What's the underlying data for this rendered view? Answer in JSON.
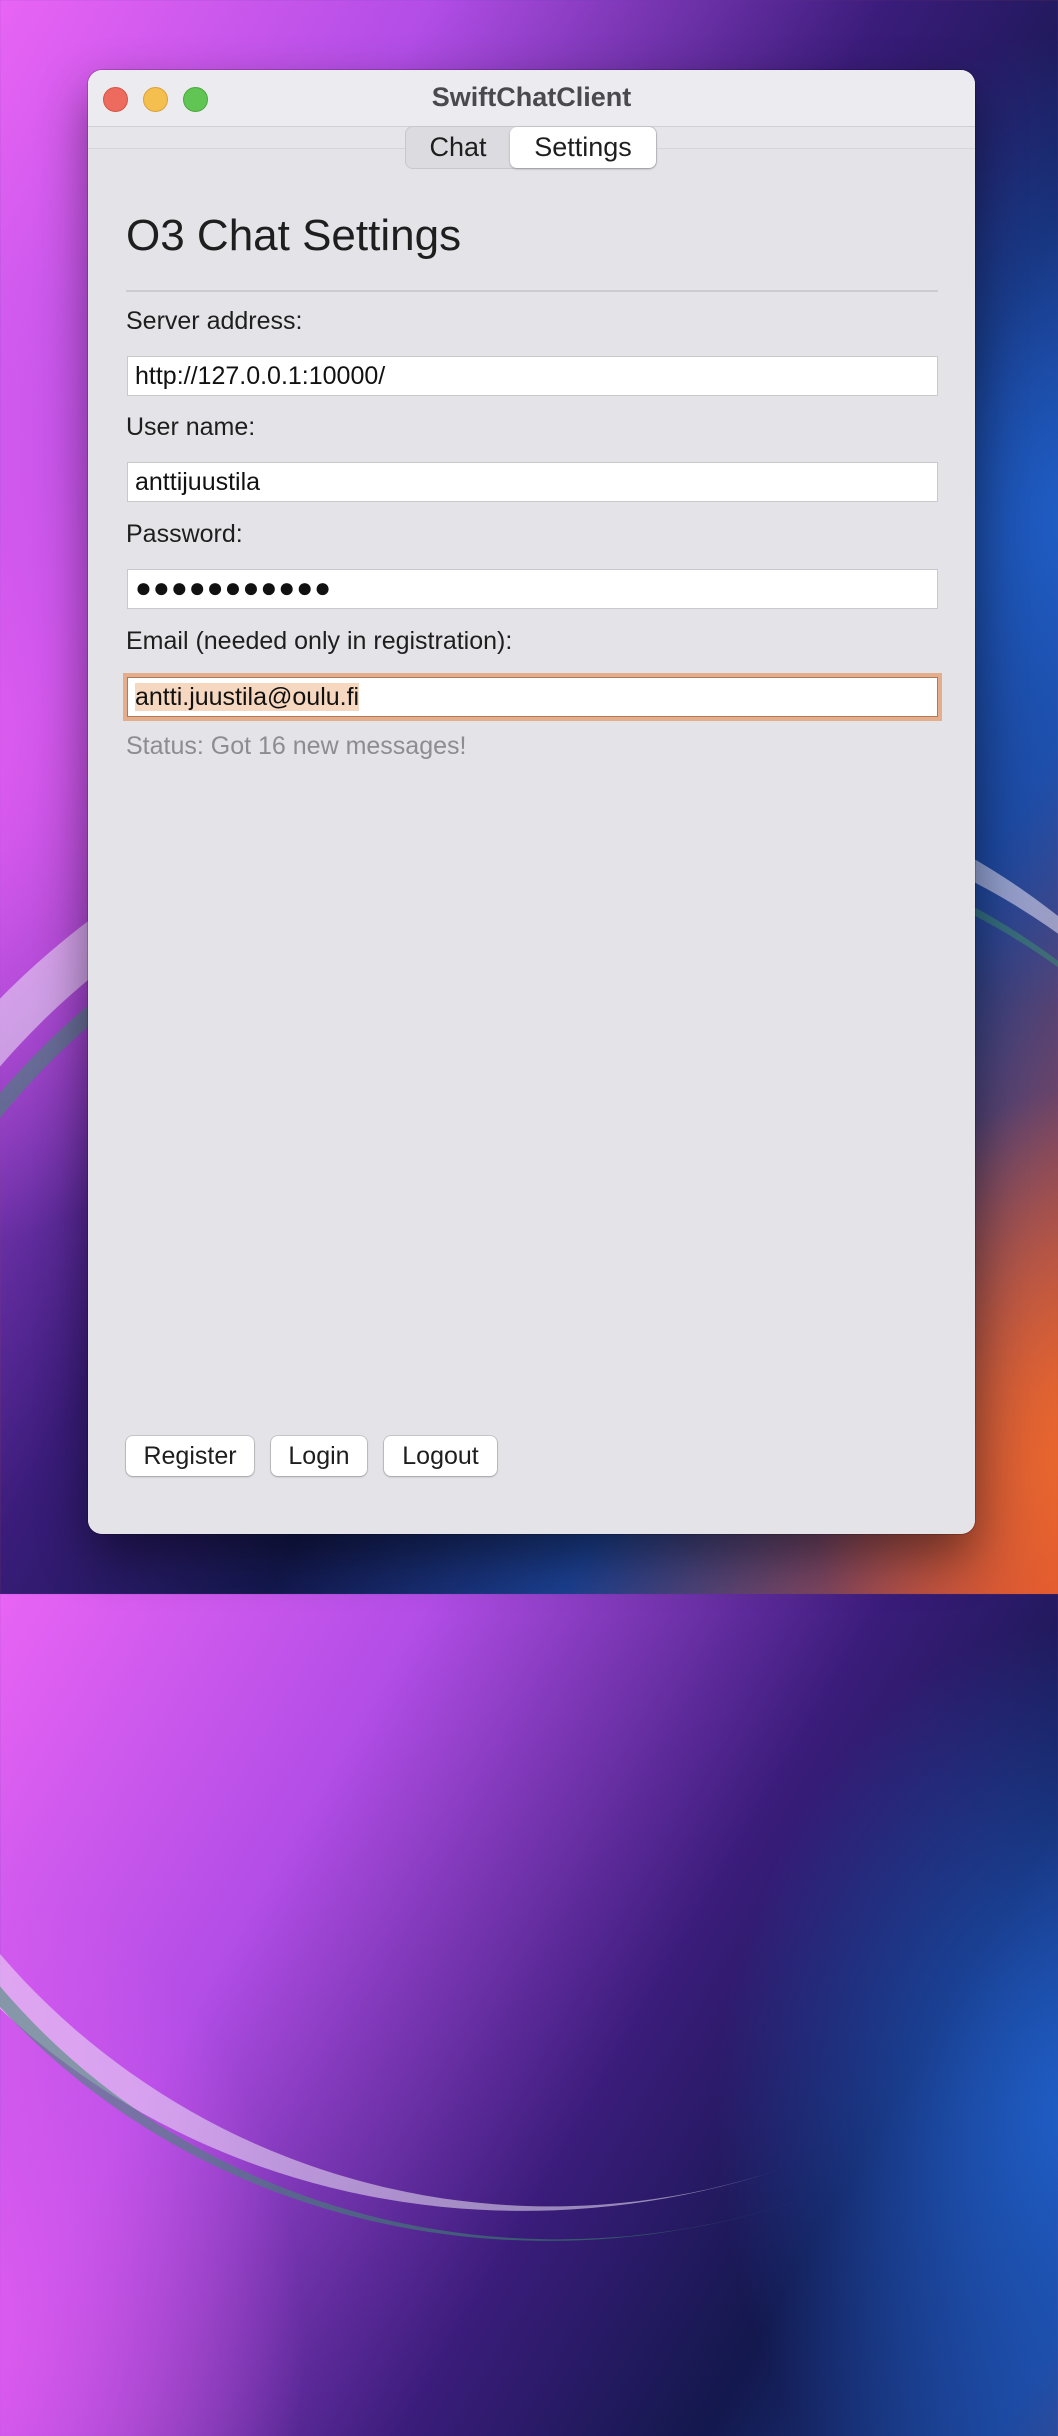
{
  "window": {
    "title": "SwiftChatClient"
  },
  "tabs": [
    {
      "label": "Chat",
      "selected": false
    },
    {
      "label": "Settings",
      "selected": true
    }
  ],
  "settings": {
    "heading": "O3 Chat Settings",
    "server_label": "Server address:",
    "server_value": "http://127.0.0.1:10000/",
    "username_label": "User name:",
    "username_value": "anttijuustila",
    "password_label": "Password:",
    "password_masked": "●●●●●●●●●●●",
    "email_label": "Email (needed only in registration):",
    "email_value": "antti.juustila@oulu.fi",
    "status": "Status: Got 16 new messages!"
  },
  "buttons": {
    "register": "Register",
    "login": "Login",
    "logout": "Logout"
  },
  "colors": {
    "focus_ring": "#e4ae8c",
    "selection": "#f6d7c0",
    "close": "#ed6a5e",
    "minimize": "#f5bf4f",
    "zoom": "#61c554"
  }
}
